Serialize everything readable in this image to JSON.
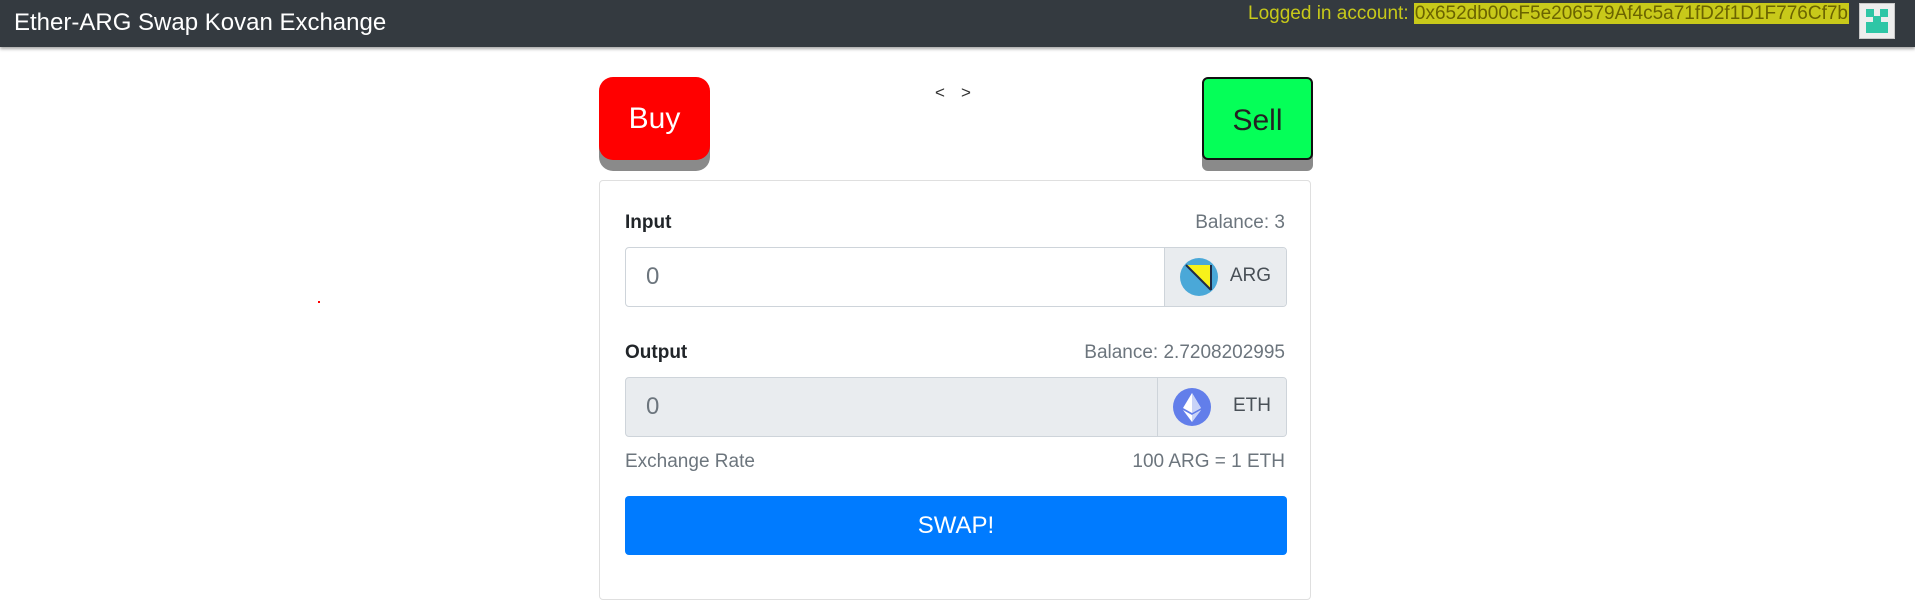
{
  "navbar": {
    "title": "Ether-ARG Swap Kovan Exchange",
    "account_label": "Logged in account: ",
    "account_address": "0x652db00cF5e206579Af4c5a71fD2f1D1F776Cf7b"
  },
  "mode_buttons": {
    "buy_label": "Buy",
    "sell_label": "Sell",
    "prev_label": "<",
    "next_label": ">"
  },
  "input": {
    "label": "Input",
    "balance": "Balance: 3",
    "placeholder": "0",
    "token": "ARG"
  },
  "output": {
    "label": "Output",
    "balance": "Balance: 2.7208202995",
    "placeholder": "0",
    "token": "ETH"
  },
  "exchange_rate": {
    "label": "Exchange Rate",
    "value": "100 ARG = 1 ETH"
  },
  "swap_button": {
    "label": "SWAP!"
  },
  "colors": {
    "navbar_bg": "#343a40",
    "buy": "#ff0000",
    "sell": "#05ff58",
    "swap": "#007bff",
    "address_highlight": "#c8c91a"
  },
  "icons": {
    "arg": "arg-token-icon",
    "eth": "eth-token-icon",
    "avatar": "identicon-avatar"
  }
}
